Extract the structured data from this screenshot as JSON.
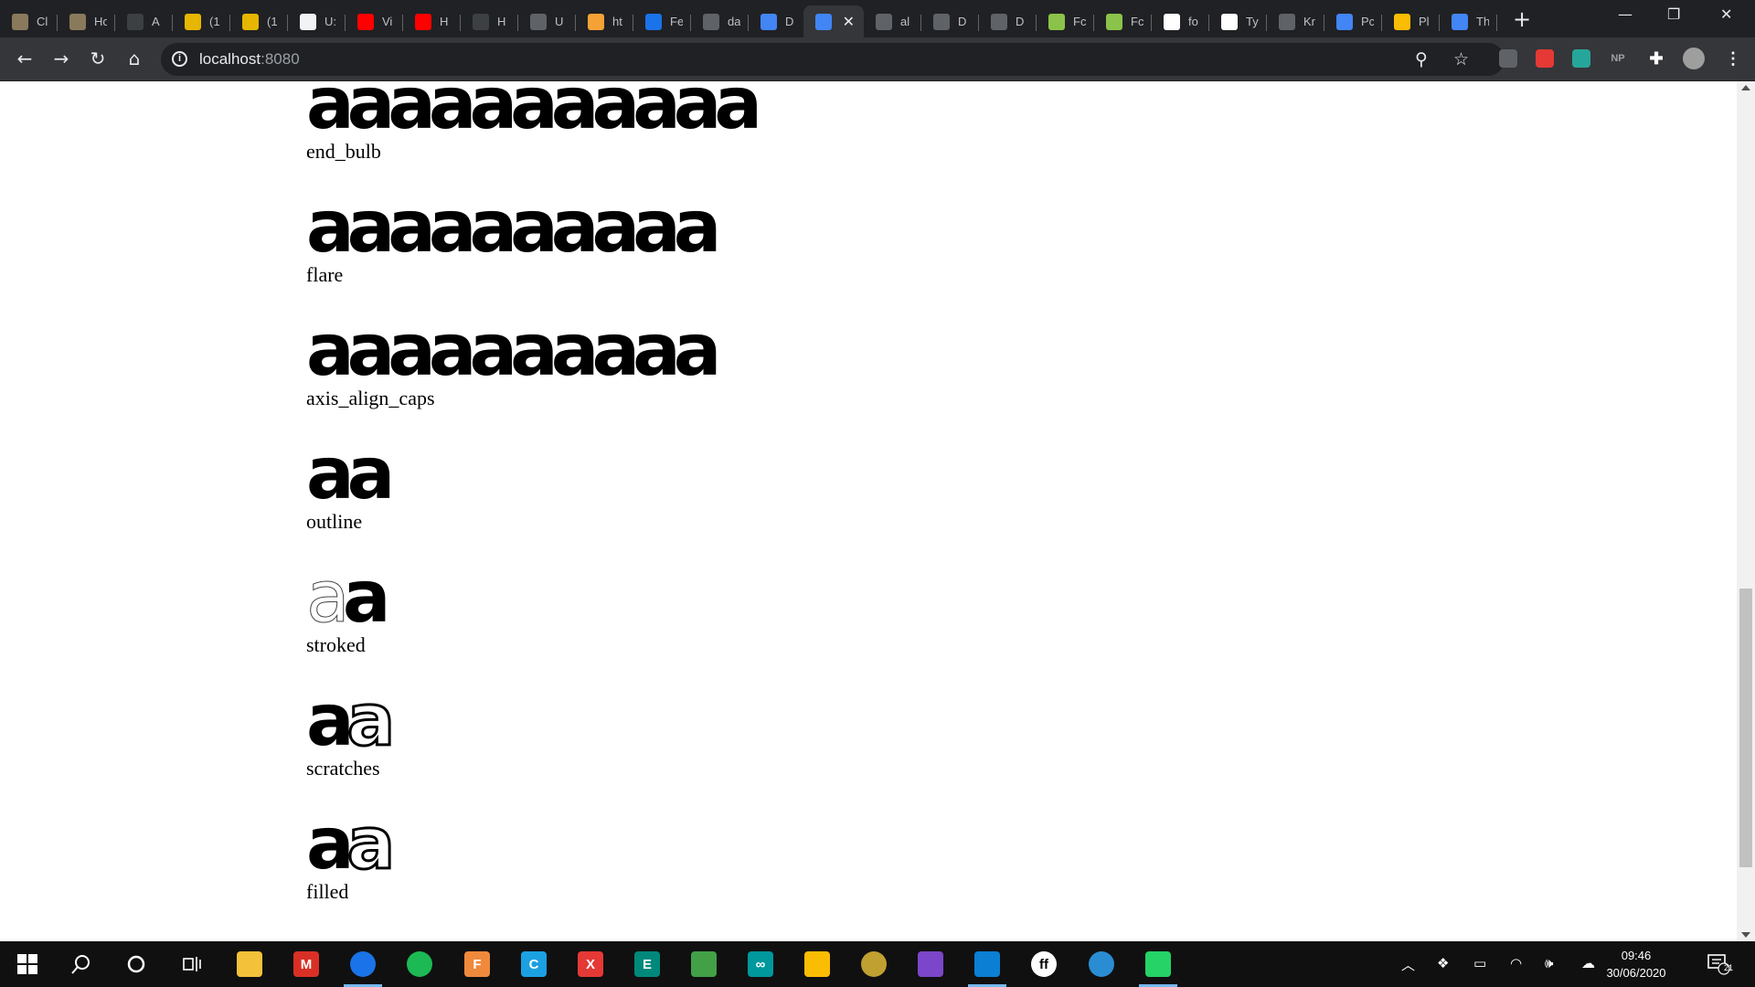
{
  "browser": {
    "tabs": [
      {
        "title": "Cl",
        "favicon_color": "#8a7a5c",
        "icon": "image-favicon"
      },
      {
        "title": "Ho",
        "favicon_color": "#8a7a5c",
        "icon": "image-favicon"
      },
      {
        "title": "A",
        "favicon_color": "#3c4043",
        "icon": "github-favicon"
      },
      {
        "title": "(1",
        "favicon_color": "#e6b600",
        "icon": "g-favicon"
      },
      {
        "title": "(1",
        "favicon_color": "#e6b600",
        "icon": "g-favicon"
      },
      {
        "title": "U:",
        "favicon_color": "#f1f3f4",
        "icon": "pattern-favicon"
      },
      {
        "title": "Vi",
        "favicon_color": "#ff0000",
        "icon": "youtube-favicon"
      },
      {
        "title": "H",
        "favicon_color": "#ff0000",
        "icon": "youtube-favicon"
      },
      {
        "title": "H",
        "favicon_color": "#3c4043",
        "icon": "dots-favicon"
      },
      {
        "title": "U",
        "favicon_color": "#5f6368",
        "icon": "globe-favicon"
      },
      {
        "title": "ht",
        "favicon_color": "#f4a235",
        "icon": "s-favicon"
      },
      {
        "title": "Fe",
        "favicon_color": "#1a73e8",
        "icon": "gd-favicon"
      },
      {
        "title": "da",
        "favicon_color": "#5f6368",
        "icon": "globe-favicon"
      },
      {
        "title": "D",
        "favicon_color": "#4285f4",
        "icon": "flutter-favicon"
      },
      {
        "title": "",
        "favicon_color": "#4285f4",
        "icon": "flutter-favicon",
        "active": true
      },
      {
        "title": "al",
        "favicon_color": "#5f6368",
        "icon": "globe-favicon"
      },
      {
        "title": "D",
        "favicon_color": "#5f6368",
        "icon": "globe-favicon"
      },
      {
        "title": "D",
        "favicon_color": "#5f6368",
        "icon": "globe-favicon"
      },
      {
        "title": "Fc",
        "favicon_color": "#8bc34a",
        "icon": "ampersand-favicon"
      },
      {
        "title": "Fc",
        "favicon_color": "#8bc34a",
        "icon": "ampersand-favicon"
      },
      {
        "title": "fo",
        "favicon_color": "#ffffff",
        "icon": "google-favicon"
      },
      {
        "title": "Ty",
        "favicon_color": "#ffffff",
        "icon": "type-favicon"
      },
      {
        "title": "Kr",
        "favicon_color": "#5f6368",
        "icon": "globe-favicon"
      },
      {
        "title": "Pc",
        "favicon_color": "#4285f4",
        "icon": "flutter-favicon"
      },
      {
        "title": "Pl",
        "favicon_color": "#fbbc04",
        "icon": "pinwheel-favicon"
      },
      {
        "title": "Th",
        "favicon_color": "#4285f4",
        "icon": "docs-favicon"
      }
    ],
    "new_tab_symbol": "+",
    "window_controls": {
      "minimize": "—",
      "restore": "❐",
      "close": "✕"
    },
    "url_host": "localhost",
    "url_port": ":8080",
    "extensions": [
      {
        "label": "",
        "color": "#5f6368",
        "icon": "shield-extension-icon"
      },
      {
        "label": "",
        "color": "#e53935",
        "icon": "stop-extension-icon"
      },
      {
        "label": "",
        "color": "#26a69a",
        "icon": "shirt-extension-icon"
      },
      {
        "label": "NP",
        "color": "transparent",
        "icon": "np-extension-icon"
      }
    ]
  },
  "page": {
    "samples": [
      {
        "label": "end_bulb",
        "glyphs": "aaaaaaaaaaa"
      },
      {
        "label": "flare",
        "glyphs": "aaaaaaaaaa"
      },
      {
        "label": "axis_align_caps",
        "glyphs": "aaaaaaaaaa"
      },
      {
        "label": "outline",
        "glyphs": "aa"
      },
      {
        "label": "stroked",
        "glyphs": "aa"
      },
      {
        "label": "scratches",
        "glyphs": "aa"
      },
      {
        "label": "filled",
        "glyphs": "aa"
      }
    ]
  },
  "taskbar": {
    "apps": [
      {
        "name": "file-explorer",
        "color": "#f3c13a",
        "label": ""
      },
      {
        "name": "gmail",
        "color": "#d93025",
        "label": "M"
      },
      {
        "name": "chrome",
        "color": "#1a73e8",
        "label": "",
        "running": true
      },
      {
        "name": "spotify",
        "color": "#1db954",
        "label": ""
      },
      {
        "name": "fontforge",
        "color": "#ef8a3c",
        "label": "F"
      },
      {
        "name": "ccleaner",
        "color": "#1ba1e2",
        "label": "C"
      },
      {
        "name": "xmind",
        "color": "#e53935",
        "label": "X"
      },
      {
        "name": "terminal",
        "color": "#00897b",
        "label": "E"
      },
      {
        "name": "image-viewer",
        "color": "#43a047",
        "label": ""
      },
      {
        "name": "arduino",
        "color": "#00979d",
        "label": "∞"
      },
      {
        "name": "keep",
        "color": "#fbbc04",
        "label": ""
      },
      {
        "name": "globe-app",
        "color": "#c0a030",
        "label": ""
      },
      {
        "name": "visual-studio",
        "color": "#7b46c9",
        "label": ""
      },
      {
        "name": "vscode",
        "color": "#0a7fd4",
        "label": "",
        "running": true
      },
      {
        "name": "fontlab",
        "color": "#ffffff",
        "label": "ff"
      },
      {
        "name": "edge",
        "color": "#2a8dd4",
        "label": ""
      },
      {
        "name": "whatsapp",
        "color": "#25d366",
        "label": "",
        "running": true
      }
    ],
    "clock_time": "09:46",
    "clock_date": "30/06/2020",
    "notification_count": "21"
  }
}
